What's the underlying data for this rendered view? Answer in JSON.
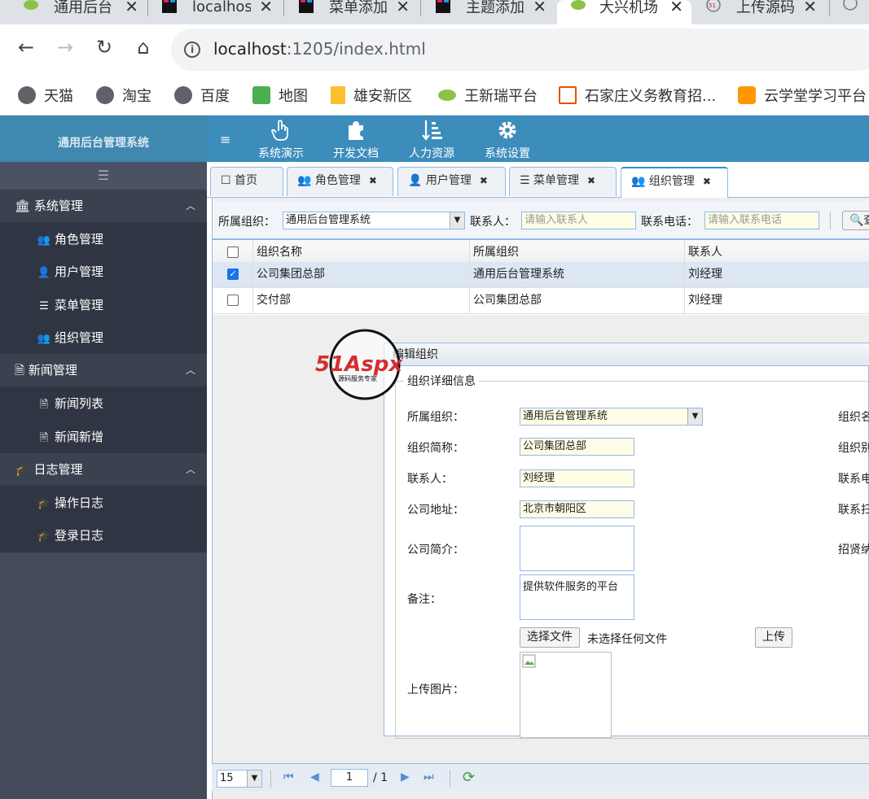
{
  "browser": {
    "tabs": [
      {
        "label": "通用后台",
        "icon": "leaf-icon"
      },
      {
        "label": "localhos",
        "icon": "intellij-icon"
      },
      {
        "label": "菜单添加",
        "icon": "intellij-icon"
      },
      {
        "label": "主题添加",
        "icon": "intellij-icon"
      },
      {
        "label": "大兴机场",
        "icon": "leaf-icon"
      },
      {
        "label": "上传源码",
        "icon": "51aspx-icon"
      }
    ],
    "url_host": "localhost",
    "url_rest": ":1205/index.html",
    "bookmarks": [
      "天猫",
      "淘宝",
      "百度",
      "地图",
      "雄安新区",
      "王新瑞平台",
      "石家庄义务教育招...",
      "云学堂学习平台"
    ]
  },
  "app": {
    "brand": "通用后台管理系统",
    "top_menu": [
      "系统演示",
      "开发文档",
      "人力资源",
      "系统设置"
    ],
    "sidebar": {
      "groups": [
        {
          "label": "系统管理",
          "items": [
            "角色管理",
            "用户管理",
            "菜单管理",
            "组织管理"
          ]
        },
        {
          "label": "新闻管理",
          "items": [
            "新闻列表",
            "新闻新增"
          ]
        },
        {
          "label": "日志管理",
          "items": [
            "操作日志",
            "登录日志"
          ]
        }
      ]
    },
    "content_tabs": [
      "首页",
      "角色管理",
      "用户管理",
      "菜单管理",
      "组织管理"
    ],
    "toolbar": {
      "org_label": "所属组织：",
      "org_value": "通用后台管理系统",
      "contact_label": "联系人：",
      "contact_placeholder": "请输入联系人",
      "phone_label": "联系电话：",
      "phone_placeholder": "请输入联系电话",
      "search_label": "查"
    },
    "grid": {
      "columns": [
        "组织名称",
        "所属组织",
        "联系人"
      ],
      "rows": [
        {
          "checked": true,
          "cells": [
            "公司集团总部",
            "通用后台管理系统",
            "刘经理"
          ]
        },
        {
          "checked": false,
          "cells": [
            "交付部",
            "公司集团总部",
            "刘经理"
          ]
        }
      ]
    },
    "dialog": {
      "title": "编辑组织",
      "legend": "组织详细信息",
      "fields": {
        "parent_org_label": "所属组织：",
        "parent_org_value": "通用后台管理系统",
        "short_name_label": "组织简称：",
        "short_name_value": "公司集团总部",
        "contact_label": "联系人：",
        "contact_value": "刘经理",
        "address_label": "公司地址：",
        "address_value": "北京市朝阳区",
        "intro_label": "公司简介：",
        "intro_value": "",
        "remark_label": "备注：",
        "remark_value": "提供软件服务的平台",
        "upload_image_label": "上传图片：",
        "choose_file_btn": "选择文件",
        "no_file_text": "未选择任何文件",
        "upload_btn": "上传"
      },
      "right_labels": [
        "组织名",
        "组织别",
        "联系电",
        "联系扫",
        "招贤纳"
      ]
    },
    "pager": {
      "page_size": "15",
      "page_number": "1",
      "page_total": "/ 1"
    },
    "watermark": {
      "text": "51Aspx",
      "subtext": "源码服务专家"
    }
  }
}
